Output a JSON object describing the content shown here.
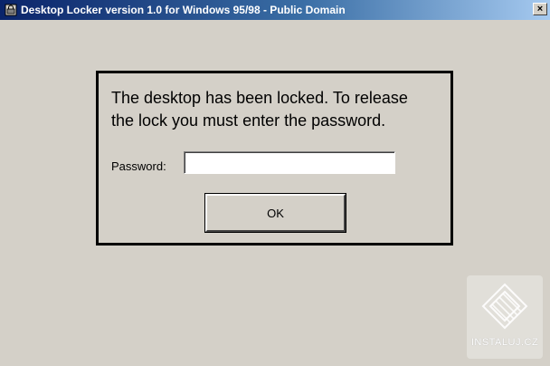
{
  "window": {
    "title": "Desktop Locker version 1.0 for Windows 95/98 - Public Domain",
    "close_label": "×"
  },
  "dialog": {
    "message_line1": "The desktop has been locked.  To release",
    "message_line2": "the lock you must enter the password.",
    "password_label": "Password:",
    "password_value": "",
    "ok_label": "OK"
  },
  "watermark": {
    "text": "INSTALUJ.CZ",
    "icon": "instaluj-logo"
  },
  "colors": {
    "titlebar_start": "#0a246a",
    "titlebar_end": "#a6caf0",
    "background": "#d4d0c8"
  }
}
